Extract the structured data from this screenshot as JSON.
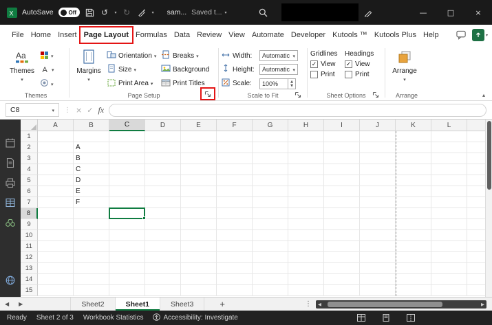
{
  "titlebar": {
    "autosave_label": "AutoSave",
    "autosave_state": "Off",
    "doc_name": "sam...",
    "saved_status": "Saved t..."
  },
  "icons": {
    "undo": "↺",
    "redo": "↻",
    "chevron": "▾",
    "minimize": "—",
    "maximize": "□",
    "close": "×",
    "prev": "◀",
    "next": "▶",
    "dots": "⋮",
    "plus": "+",
    "collapse": "▴",
    "cancel": "×",
    "checkmark": "✓",
    "spin_up": "▲",
    "spin_down": "▼"
  },
  "ribbon_tabs": [
    {
      "label": "File"
    },
    {
      "label": "Home"
    },
    {
      "label": "Insert"
    },
    {
      "label": "Page Layout",
      "active": true,
      "annotated": true
    },
    {
      "label": "Formulas"
    },
    {
      "label": "Data"
    },
    {
      "label": "Review"
    },
    {
      "label": "View"
    },
    {
      "label": "Automate"
    },
    {
      "label": "Developer"
    },
    {
      "label": "Kutools ™"
    },
    {
      "label": "Kutools Plus"
    },
    {
      "label": "Help"
    }
  ],
  "ribbon": {
    "themes": {
      "group_label": "Themes",
      "themes_button": "Themes"
    },
    "page_setup": {
      "group_label": "Page Setup",
      "margins": "Margins",
      "orientation": "Orientation",
      "size": "Size",
      "print_area": "Print Area",
      "breaks": "Breaks",
      "background": "Background",
      "print_titles": "Print Titles"
    },
    "scale_to_fit": {
      "group_label": "Scale to Fit",
      "width_label": "Width:",
      "width_value": "Automatic",
      "height_label": "Height:",
      "height_value": "Automatic",
      "scale_label": "Scale:",
      "scale_value": "100%"
    },
    "sheet_options": {
      "group_label": "Sheet Options",
      "col1_header": "Gridlines",
      "col2_header": "Headings",
      "view_label": "View",
      "print_label": "Print"
    },
    "arrange": {
      "group_label": "Arrange",
      "arrange_button": "Arrange"
    }
  },
  "formula_bar": {
    "name_box": "C8",
    "fx_label": "fx",
    "formula_value": ""
  },
  "grid": {
    "column_headers": [
      "A",
      "B",
      "C",
      "D",
      "E",
      "F",
      "G",
      "H",
      "I",
      "J",
      "K",
      "L"
    ],
    "row_count": 15,
    "cells": {
      "B2": "A",
      "B3": "B",
      "B4": "C",
      "B5": "D",
      "B6": "E",
      "B7": "F"
    },
    "active_cell": "C8",
    "selected_column": "C",
    "selected_row": 8
  },
  "sheet_tabs": {
    "tabs": [
      {
        "label": "Sheet2"
      },
      {
        "label": "Sheet1",
        "active": true
      },
      {
        "label": "Sheet3"
      }
    ]
  },
  "status_bar": {
    "ready": "Ready",
    "sheet_info": "Sheet 2 of 3",
    "workbook_statistics": "Workbook Statistics",
    "accessibility": "Accessibility: Investigate"
  },
  "annotations": {
    "highlighted_tab": "Page Layout",
    "highlighted_control": "Page Setup dialog launcher",
    "annotation_color": "#e41414"
  },
  "colors": {
    "excel_green": "#107c41",
    "titlebar_bg": "#1a1a1a",
    "statusbar_bg": "#222222",
    "arrange_icon_orange": "#e8a33d"
  }
}
